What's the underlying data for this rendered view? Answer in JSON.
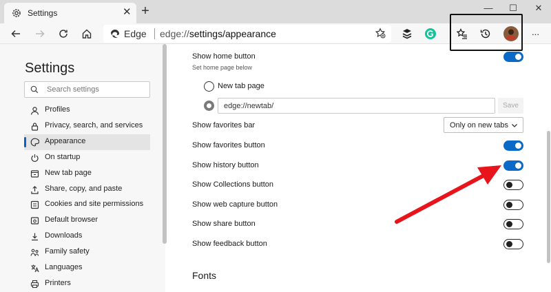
{
  "browser": {
    "tab_title": "Settings",
    "tab_close": "✕",
    "new_tab": "+",
    "window_controls": {
      "minimize": "—",
      "maximize": "☐",
      "close": "✕"
    },
    "address": {
      "site_label": "Edge",
      "url_prefix": "edge://",
      "url_path": "settings/appearance"
    },
    "menu_dots": "···"
  },
  "sidebar": {
    "title": "Settings",
    "search_placeholder": "Search settings",
    "items": [
      {
        "label": "Profiles",
        "icon": "profile-icon"
      },
      {
        "label": "Privacy, search, and services",
        "icon": "lock-icon"
      },
      {
        "label": "Appearance",
        "icon": "palette-icon",
        "active": true
      },
      {
        "label": "On startup",
        "icon": "power-icon"
      },
      {
        "label": "New tab page",
        "icon": "new-tab-icon"
      },
      {
        "label": "Share, copy, and paste",
        "icon": "share-icon"
      },
      {
        "label": "Cookies and site permissions",
        "icon": "permissions-icon"
      },
      {
        "label": "Default browser",
        "icon": "browser-icon"
      },
      {
        "label": "Downloads",
        "icon": "download-icon"
      },
      {
        "label": "Family safety",
        "icon": "family-icon"
      },
      {
        "label": "Languages",
        "icon": "languages-icon"
      },
      {
        "label": "Printers",
        "icon": "printer-icon"
      }
    ]
  },
  "main": {
    "home_button": {
      "label": "Show home button",
      "sublabel": "Set home page below",
      "enabled": true
    },
    "home_options": {
      "new_tab_page": "New tab page",
      "custom_url": "edge://newtab/",
      "save": "Save"
    },
    "favorites_bar": {
      "label": "Show favorites bar",
      "selected": "Only on new tabs"
    },
    "toggles": [
      {
        "label": "Show favorites button",
        "on": true
      },
      {
        "label": "Show history button",
        "on": true
      },
      {
        "label": "Show Collections button",
        "on": false
      },
      {
        "label": "Show web capture button",
        "on": false
      },
      {
        "label": "Show share button",
        "on": false
      },
      {
        "label": "Show feedback button",
        "on": false
      }
    ],
    "fonts_heading": "Fonts"
  },
  "colors": {
    "accent": "#0b6ac8",
    "annotation_arrow": "#e8141c",
    "highlight_box": "#111111"
  }
}
